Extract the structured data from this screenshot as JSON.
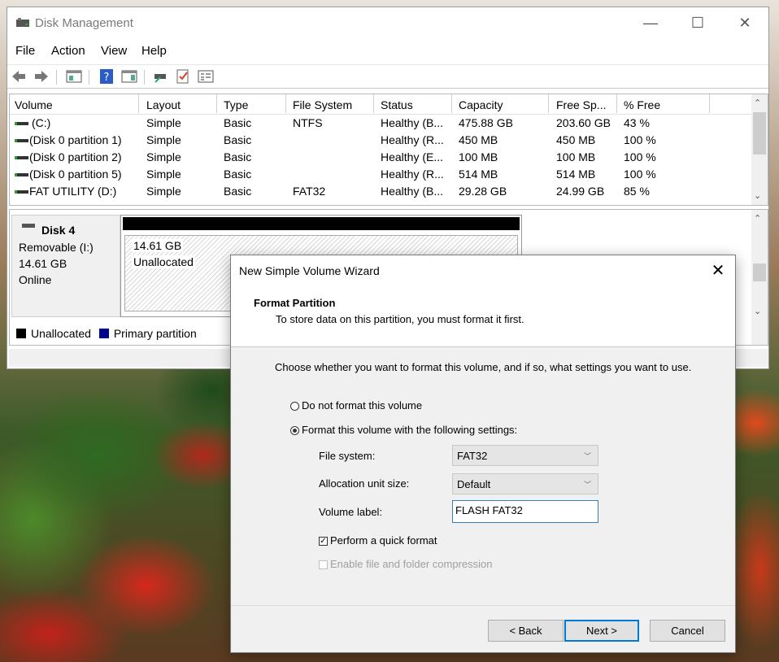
{
  "window": {
    "title": "Disk Management",
    "controls": {
      "minimize": "—",
      "maximize": "☐",
      "close": "✕"
    }
  },
  "menu": [
    "File",
    "Action",
    "View",
    "Help"
  ],
  "volumes": {
    "columns": [
      "Volume",
      "Layout",
      "Type",
      "File System",
      "Status",
      "Capacity",
      "Free Sp...",
      "% Free"
    ],
    "rows": [
      [
        "(C:)",
        "Simple",
        "Basic",
        "NTFS",
        "Healthy (B...",
        "475.88 GB",
        "203.60 GB",
        "43 %"
      ],
      [
        "(Disk 0 partition 1)",
        "Simple",
        "Basic",
        "",
        "Healthy (R...",
        "450 MB",
        "450 MB",
        "100 %"
      ],
      [
        "(Disk 0 partition 2)",
        "Simple",
        "Basic",
        "",
        "Healthy (E...",
        "100 MB",
        "100 MB",
        "100 %"
      ],
      [
        "(Disk 0 partition 5)",
        "Simple",
        "Basic",
        "",
        "Healthy (R...",
        "514 MB",
        "514 MB",
        "100 %"
      ],
      [
        "FAT UTILITY (D:)",
        "Simple",
        "Basic",
        "FAT32",
        "Healthy (B...",
        "29.28 GB",
        "24.99 GB",
        "85 %"
      ]
    ]
  },
  "disk": {
    "name": "Disk 4",
    "type": "Removable (I:)",
    "size": "14.61 GB",
    "state": "Online",
    "partition_size": "14.61 GB",
    "partition_state": "Unallocated"
  },
  "legend": {
    "unallocated": "Unallocated",
    "primary": "Primary partition"
  },
  "colors": {
    "unallocated": "#000000",
    "primary": "#00008b",
    "accent": "#0078d7"
  },
  "wizard": {
    "title": "New Simple Volume Wizard",
    "close": "✕",
    "heading": "Format Partition",
    "subheading": "To store data on this partition, you must format it first.",
    "instruction": "Choose whether you want to format this volume, and if so, what settings you want to use.",
    "option_no_format": "Do not format this volume",
    "option_format": "Format this volume with the following settings:",
    "file_system_label": "File system:",
    "file_system_value": "FAT32",
    "alloc_label": "Allocation unit size:",
    "alloc_value": "Default",
    "volume_label_label": "Volume label:",
    "volume_label_value": "FLASH FAT32",
    "quick_format": "Perform a quick format",
    "compression": "Enable file and folder compression",
    "back": "< Back",
    "next": "Next >",
    "cancel": "Cancel"
  }
}
